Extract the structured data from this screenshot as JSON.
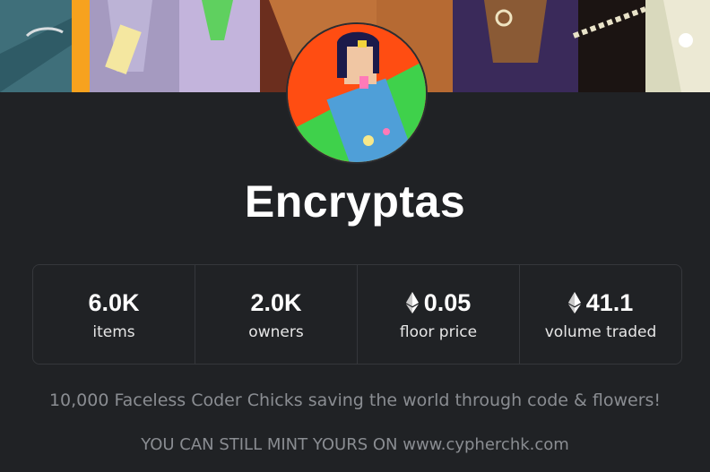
{
  "collection": {
    "name": "Encryptas",
    "description": "10,000 Faceless Coder Chicks saving the world through code & flowers!",
    "mint_note": "YOU CAN STILL MINT YOURS ON www.cypherchk.com"
  },
  "stats": [
    {
      "value": "6.0K",
      "label": "items",
      "icon": null
    },
    {
      "value": "2.0K",
      "label": "owners",
      "icon": null
    },
    {
      "value": "0.05",
      "label": "floor price",
      "icon": "ethereum-icon"
    },
    {
      "value": "41.1",
      "label": "volume traded",
      "icon": "ethereum-icon"
    }
  ],
  "colors": {
    "background": "#202225",
    "border": "#35373b",
    "muted_text": "#8a8d92",
    "avatar_bg": "#ff4d12",
    "avatar_green": "#3fd14b"
  }
}
